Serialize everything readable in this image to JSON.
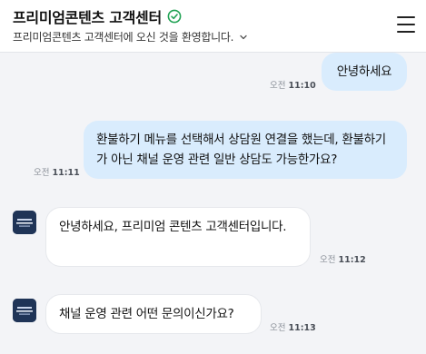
{
  "header": {
    "title": "프리미엄콘텐츠 고객센터",
    "subtitle": "프리미엄콘텐츠 고객센터에 오신 것을 환영합니다.",
    "verified_icon": "check-circle-icon",
    "menu_icon": "hamburger-menu-icon",
    "accent_color": "#22a355"
  },
  "messages": [
    {
      "sender": "user",
      "text": "안녕하세요",
      "ampm": "오전",
      "time": "11:10"
    },
    {
      "sender": "user",
      "text": "환불하기 메뉴를 선택해서 상담원 연결을 했는데, 환불하기가 아닌 채널 운영 관련 일반 상담도 가능한가요?",
      "ampm": "오전",
      "time": "11:11"
    },
    {
      "sender": "agent",
      "text": "안녕하세요, 프리미엄 콘텐츠 고객센터입니다.",
      "ampm": "오전",
      "time": "11:12"
    },
    {
      "sender": "agent",
      "text": "채널 운영 관련 어떤 문의이신가요?",
      "ampm": "오전",
      "time": "11:13"
    }
  ],
  "colors": {
    "user_bubble": "#d9ecfd",
    "agent_bubble": "#ffffff",
    "background": "#f3f4f7"
  }
}
